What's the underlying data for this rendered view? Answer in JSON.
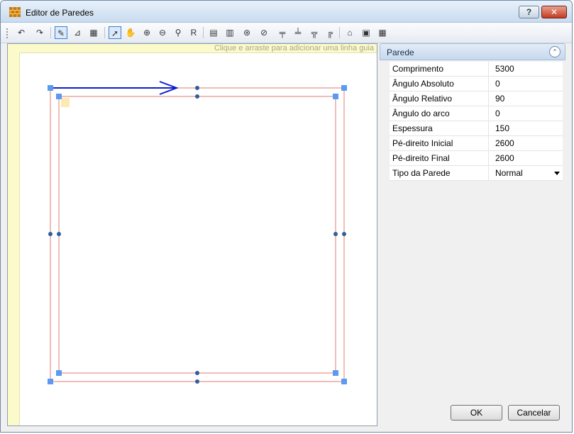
{
  "window": {
    "title": "Editor de Paredes",
    "help_label": "?",
    "close_label": "✕"
  },
  "toolbar": {
    "tools": [
      {
        "name": "undo-icon",
        "glyph": "↶"
      },
      {
        "name": "redo-icon",
        "glyph": "↷"
      },
      {
        "name": "draw-wall-icon",
        "glyph": "✎"
      },
      {
        "name": "split-wall-icon",
        "glyph": "⊿"
      },
      {
        "name": "grid-icon",
        "glyph": "▦"
      },
      {
        "name": "select-pointer-icon",
        "glyph": "➚"
      },
      {
        "name": "pan-hand-icon",
        "glyph": "✋"
      },
      {
        "name": "zoom-in-icon",
        "glyph": "⊕"
      },
      {
        "name": "zoom-out-icon",
        "glyph": "⊖"
      },
      {
        "name": "zoom-fit-icon",
        "glyph": "⚲"
      },
      {
        "name": "refresh-r-icon",
        "glyph": "R"
      },
      {
        "name": "wall-add-icon",
        "glyph": "▤"
      },
      {
        "name": "wall-remove-icon",
        "glyph": "▥"
      },
      {
        "name": "node-add-icon",
        "glyph": "⊛"
      },
      {
        "name": "node-remove-icon",
        "glyph": "⊘"
      },
      {
        "name": "align-top-icon",
        "glyph": "╤"
      },
      {
        "name": "align-vertical-icon",
        "glyph": "╧"
      },
      {
        "name": "align-bottom-icon",
        "glyph": "╦"
      },
      {
        "name": "corner-icon",
        "glyph": "╔"
      },
      {
        "name": "house-icon",
        "glyph": "⌂"
      },
      {
        "name": "import-icon",
        "glyph": "▣"
      },
      {
        "name": "table-icon",
        "glyph": "▦"
      }
    ]
  },
  "canvas": {
    "guide_hint": "Clique e arraste para adicionar uma linha guia"
  },
  "panel": {
    "title": "Parede",
    "collapse_glyph": "⌃",
    "properties": [
      {
        "label": "Comprimento",
        "value": "5300"
      },
      {
        "label": "Ângulo Absoluto",
        "value": "0"
      },
      {
        "label": "Ângulo Relativo",
        "value": "90"
      },
      {
        "label": "Ângulo do arco",
        "value": "0"
      },
      {
        "label": "Espessura",
        "value": "150"
      },
      {
        "label": "Pé-direito Inicial",
        "value": "2600"
      },
      {
        "label": "Pé-direito Final",
        "value": "2600"
      },
      {
        "label": "Tipo da Parede",
        "value": "Normal"
      }
    ]
  },
  "buttons": {
    "ok": "OK",
    "cancel": "Cancelar"
  },
  "colors": {
    "wall_line": "#e07b72",
    "arrow": "#0a1fcf",
    "handle": "#5b9af0",
    "node": "#2f5e9e",
    "ruler": "#fbfacb"
  }
}
